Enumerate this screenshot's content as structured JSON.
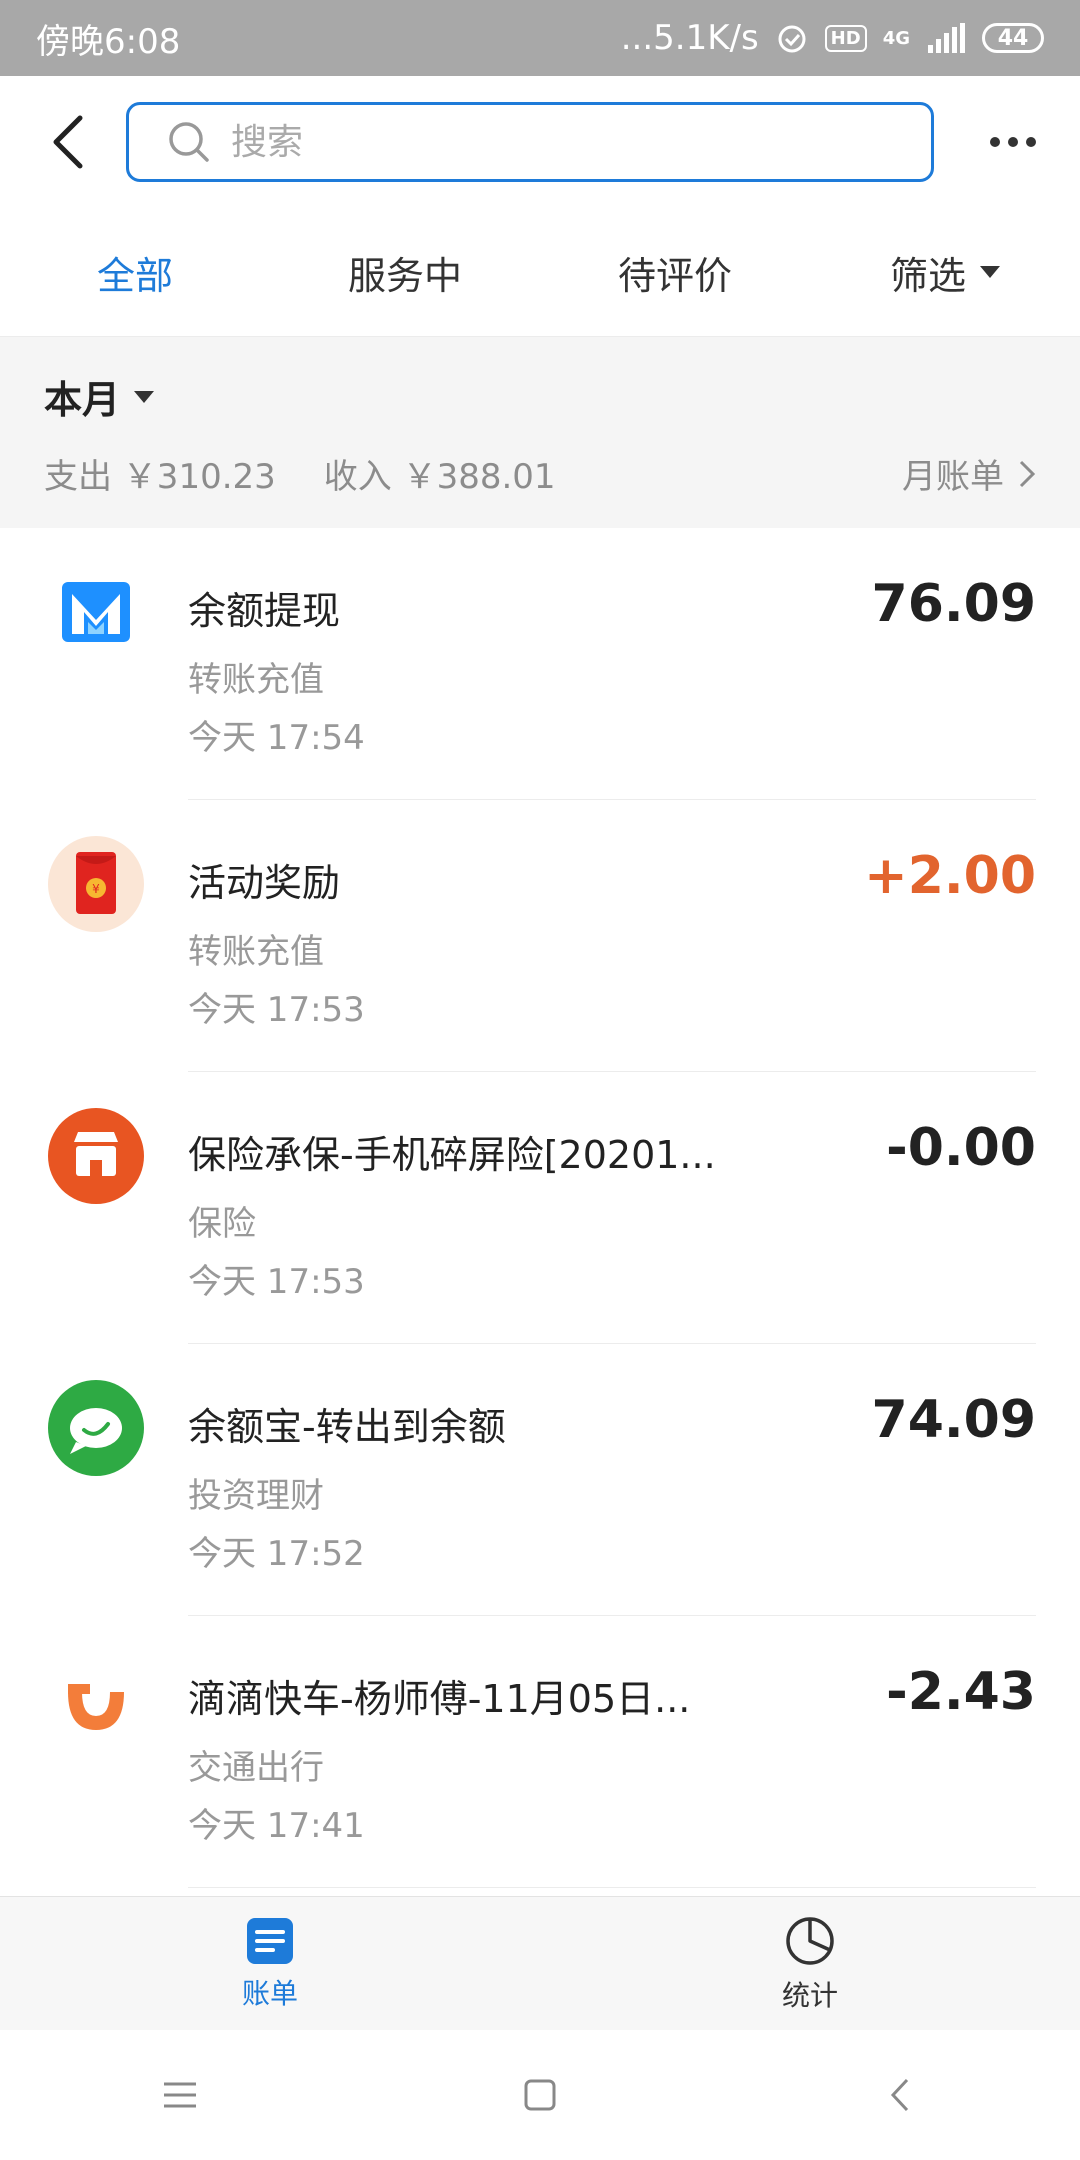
{
  "status_bar": {
    "time": "傍晚6:08",
    "network_speed": "...5.1K/s",
    "hd_label": "HD",
    "network_type": "4G",
    "battery": "44"
  },
  "header": {
    "search_placeholder": "搜索"
  },
  "tabs": [
    {
      "label": "全部"
    },
    {
      "label": "服务中"
    },
    {
      "label": "待评价"
    },
    {
      "label": "筛选"
    }
  ],
  "summary": {
    "month_label": "本月",
    "expense_text": "支出 ￥310.23",
    "income_text": "收入 ￥388.01",
    "monthly_bill_label": "月账单"
  },
  "transactions": [
    {
      "title": "余额提现",
      "category": "转账充值",
      "time": "今天  17:54",
      "amount": "76.09",
      "icon": "blue-m-logo-icon",
      "accent": "#1e90ff"
    },
    {
      "title": "活动奖励",
      "category": "转账充值",
      "time": "今天  17:53",
      "amount": "+2.00",
      "icon": "red-envelope-icon",
      "accent": "#e2642e"
    },
    {
      "title": "保险承保-手机碎屏险[20201...",
      "category": "保险",
      "time": "今天  17:53",
      "amount": "-0.00",
      "icon": "store-icon",
      "accent": "#e85522"
    },
    {
      "title": "余额宝-转出到余额",
      "category": "投资理财",
      "time": "今天  17:52",
      "amount": "74.09",
      "icon": "yuebao-icon",
      "accent": "#2eaa44"
    },
    {
      "title": "滴滴快车-杨师傅-11月05日...",
      "category": "交通出行",
      "time": "今天  17:41",
      "amount": "-2.43",
      "icon": "didi-icon",
      "accent": "#f37d3a"
    }
  ],
  "bottom_tabs": [
    {
      "label": "账单",
      "icon": "bill-icon"
    },
    {
      "label": "统计",
      "icon": "pie-chart-icon"
    }
  ],
  "colors": {
    "accent": "#1e7bd9",
    "positive_amount": "#e2642e"
  }
}
